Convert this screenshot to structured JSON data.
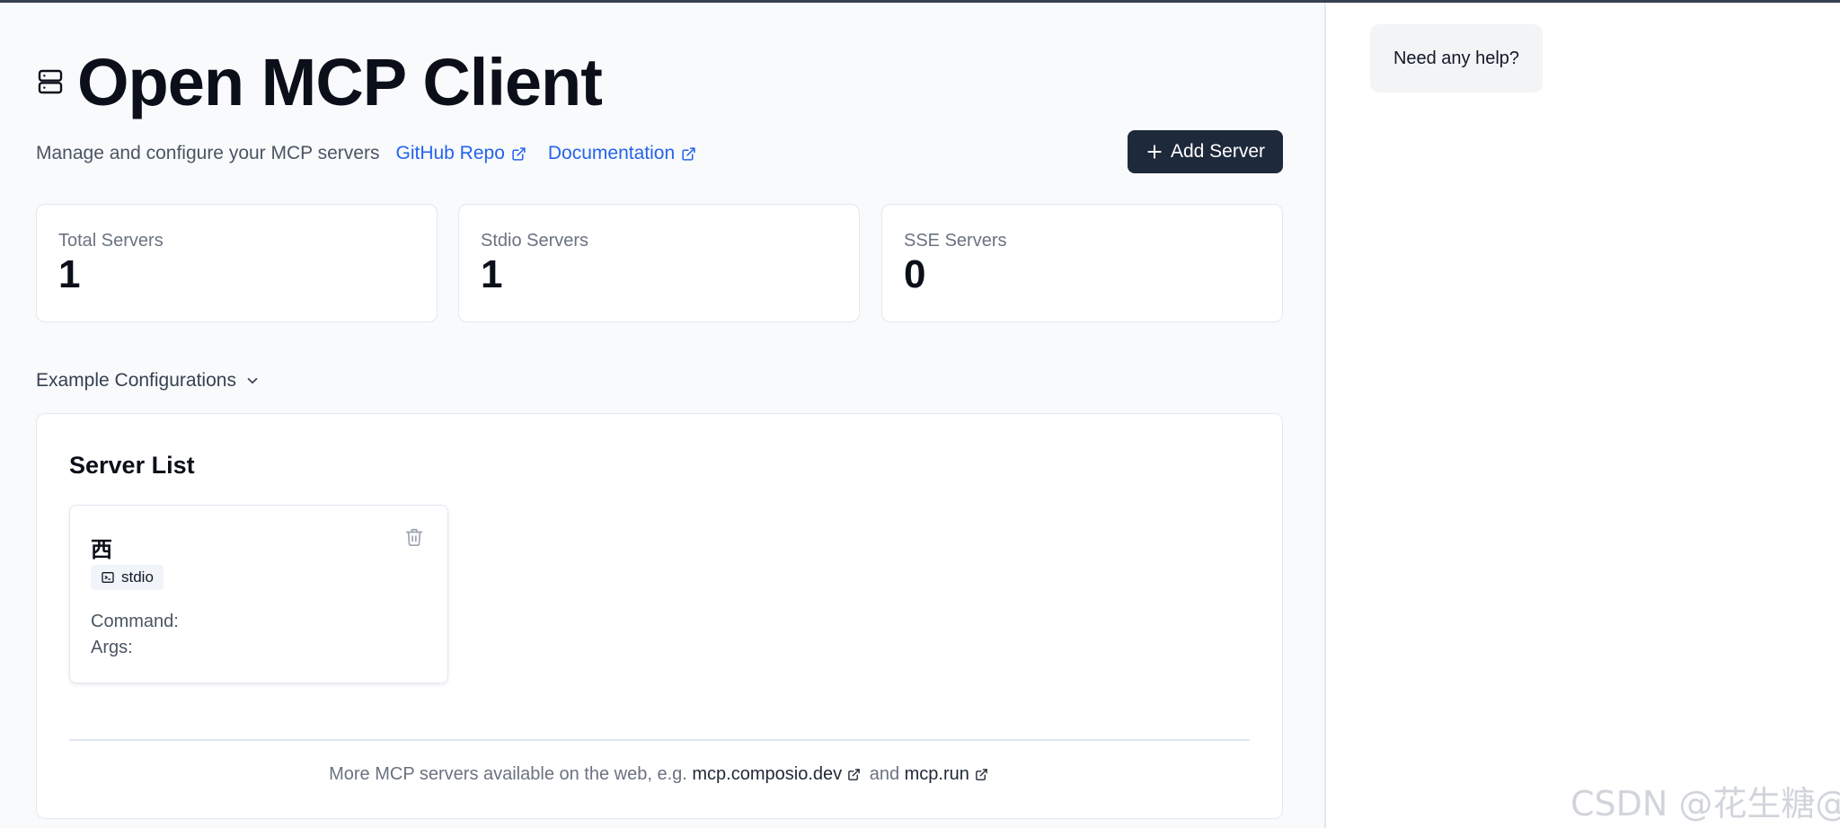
{
  "header": {
    "title": "Open MCP Client",
    "title_icon": "server-icon",
    "subtitle": "Manage and configure your MCP servers",
    "links": [
      {
        "label": "GitHub Repo",
        "icon": "external-link-icon"
      },
      {
        "label": "Documentation",
        "icon": "external-link-icon"
      }
    ],
    "add_button_label": "Add Server",
    "add_button_icon": "plus-icon"
  },
  "stats": [
    {
      "label": "Total Servers",
      "value": "1"
    },
    {
      "label": "Stdio Servers",
      "value": "1"
    },
    {
      "label": "SSE Servers",
      "value": "0"
    }
  ],
  "examples": {
    "label": "Example Configurations",
    "icon": "chevron-down-icon"
  },
  "server_list": {
    "title": "Server List",
    "servers": [
      {
        "name": "西",
        "type": "stdio",
        "type_icon": "terminal-icon",
        "command_label": "Command:",
        "args_label": "Args:",
        "delete_icon": "trash-icon"
      }
    ],
    "footer": {
      "prefix": "More MCP servers available on the web, e.g.",
      "link1": "mcp.composio.dev",
      "conjunction": "and",
      "link2": "mcp.run"
    }
  },
  "side_panel": {
    "help_text": "Need any help?"
  },
  "watermark": "CSDN @花生糖@",
  "colors": {
    "primary_button": "#1e293b",
    "link": "#2563eb",
    "background": "#f8fafc",
    "card_border": "#e2e8f0"
  }
}
